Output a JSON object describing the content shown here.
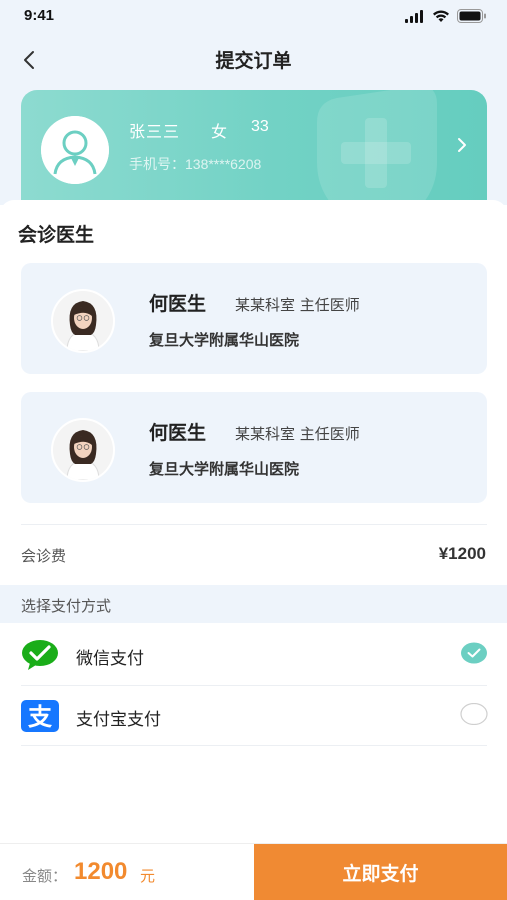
{
  "status_bar": {
    "time": "9:41"
  },
  "nav": {
    "title": "提交订单"
  },
  "patient": {
    "name": "张三三",
    "gender": "女",
    "age": "33",
    "phone": "手机号：138****6208"
  },
  "section": {
    "title": "会诊医生"
  },
  "doctors": [
    {
      "name": "何医生",
      "dept": "某某科室 主任医师",
      "hospital": "复旦大学附属华山医院"
    },
    {
      "name": "何医生",
      "dept": "某某科室 主任医师",
      "hospital": "复旦大学附属华山医院"
    }
  ],
  "fee": {
    "label": "会诊费",
    "value": "¥1200"
  },
  "payment": {
    "header": "选择支付方式",
    "options": [
      {
        "label": "微信支付",
        "icon": "wechat-pay-icon",
        "selected": true
      },
      {
        "label": "支付宝支付",
        "icon": "alipay-icon",
        "selected": false
      }
    ]
  },
  "bottom": {
    "amount_label": "金额：",
    "amount_value": "1200",
    "amount_unit": "元",
    "pay_button": "立即支付"
  },
  "colors": {
    "accent": "#6ccfc2",
    "orange": "#f08a33",
    "card_bg": "#eef4fb",
    "wechat": "#1aad19",
    "alipay": "#1677ff"
  }
}
